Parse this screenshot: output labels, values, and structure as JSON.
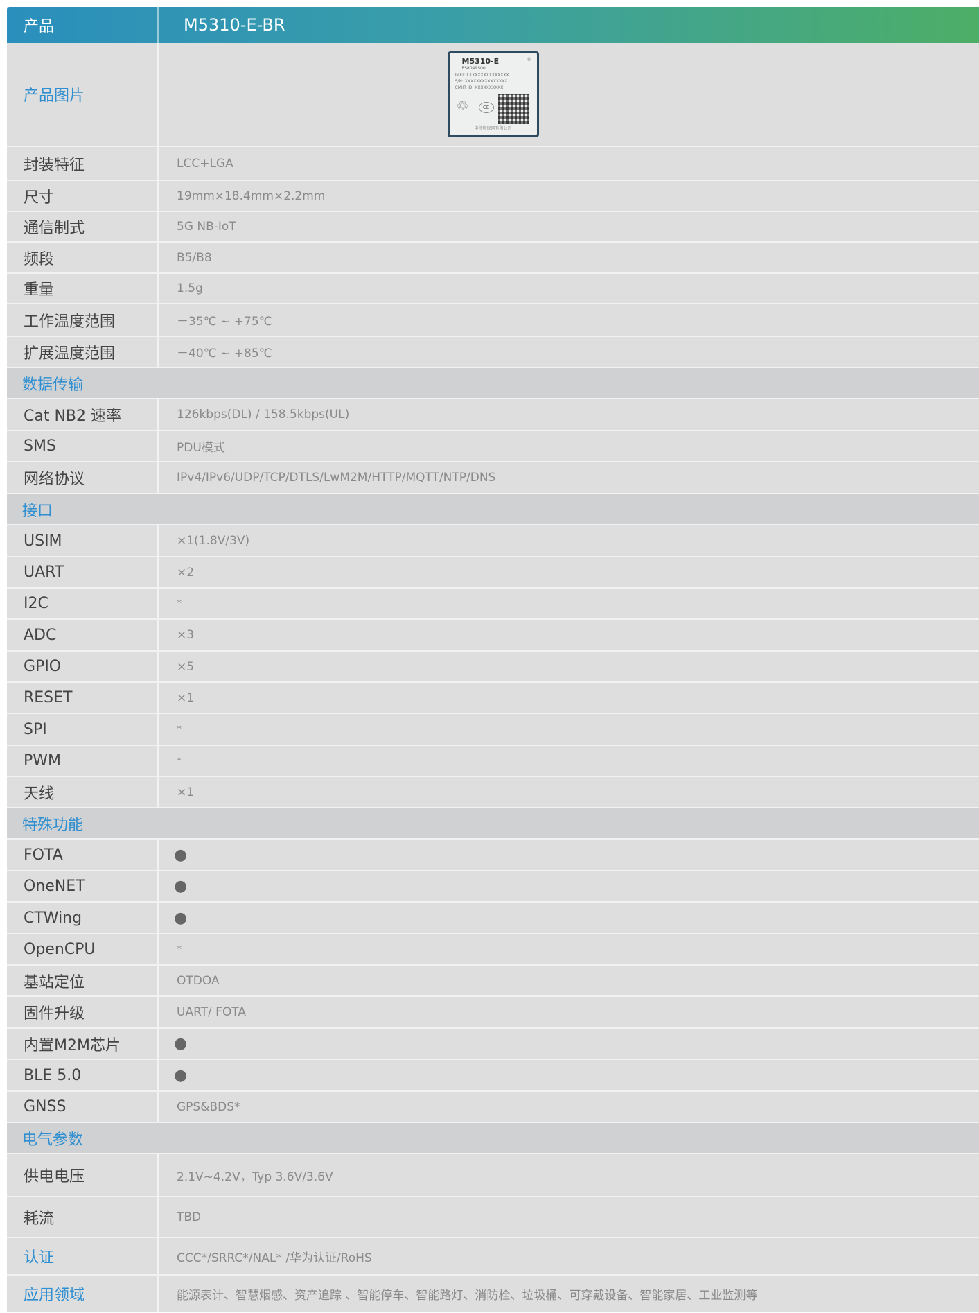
{
  "header": {
    "label": "产品",
    "value": "M5310-E-BR"
  },
  "image_row": {
    "label": "产品图片",
    "module": {
      "name": "M5310-E",
      "sub": "PS8049S00",
      "imei": "IMEI:  XXXXXXXXXXXXXXX",
      "sn": "S/N:  XXXXXXXXXXXXXXX",
      "cmiit": "CMIIT ID:  XXXXXXXXXX",
      "foot": "中移物联网有限公司"
    }
  },
  "basic": [
    {
      "label": "封装特征",
      "value": "LCC+LGA"
    },
    {
      "label": "尺寸",
      "value": "19mm×18.4mm×2.2mm"
    },
    {
      "label": "通信制式",
      "value": "5G NB-IoT"
    },
    {
      "label": "频段",
      "value": "B5/B8"
    },
    {
      "label": "重量",
      "value": "1.5g"
    },
    {
      "label": "工作温度范围",
      "value": "－35℃ ~ +75℃"
    },
    {
      "label": "扩展温度范围",
      "value": "－40℃ ~ +85℃"
    }
  ],
  "sec_data": "数据传输",
  "data_rows": [
    {
      "label": "Cat NB2 速率",
      "value": "126kbps(DL) / 158.5kbps(UL)"
    },
    {
      "label": "SMS",
      "value": "PDU模式"
    },
    {
      "label": "网络协议",
      "value": "IPv4/IPv6/UDP/TCP/DTLS/LwM2M/HTTP/MQTT/NTP/DNS"
    }
  ],
  "sec_if": "接口",
  "if_rows": [
    {
      "label": "USIM",
      "value": "×1(1.8V/3V)"
    },
    {
      "label": "UART",
      "value": "×2"
    },
    {
      "label": "I2C",
      "value": "*"
    },
    {
      "label": "ADC",
      "value": "×3"
    },
    {
      "label": "GPIO",
      "value": "×5"
    },
    {
      "label": "RESET",
      "value": "×1"
    },
    {
      "label": "SPI",
      "value": "*"
    },
    {
      "label": "PWM",
      "value": "*"
    },
    {
      "label": "天线",
      "value": "×1"
    }
  ],
  "sec_sp": "特殊功能",
  "sp_rows": [
    {
      "label": "FOTA",
      "value": "●"
    },
    {
      "label": "OneNET",
      "value": "●"
    },
    {
      "label": "CTWing",
      "value": "●"
    },
    {
      "label": "OpenCPU",
      "value": "*"
    },
    {
      "label": "基站定位",
      "value": "OTDOA"
    },
    {
      "label": "固件升级",
      "value": "UART/ FOTA"
    },
    {
      "label": "内置M2M芯片",
      "value": "●"
    },
    {
      "label": "BLE 5.0",
      "value": "●"
    },
    {
      "label": "GNSS",
      "value": "GPS&BDS*"
    }
  ],
  "sec_el": "电气参数",
  "el_rows": [
    {
      "label": "供电电压",
      "value": "2.1V~4.2V，Typ 3.6V/3.6V"
    },
    {
      "label": "耗流",
      "value": "TBD"
    }
  ],
  "cert": {
    "label": "认证",
    "value": "CCC*/SRRC*/NAL* /华为认证/RoHS"
  },
  "app": {
    "label": "应用领域",
    "value": "能源表计、智慧烟感、资产追踪 、智能停车、智能路灯、消防栓、垃圾桶、可穿戴设备、智能家居、工业监测等"
  }
}
